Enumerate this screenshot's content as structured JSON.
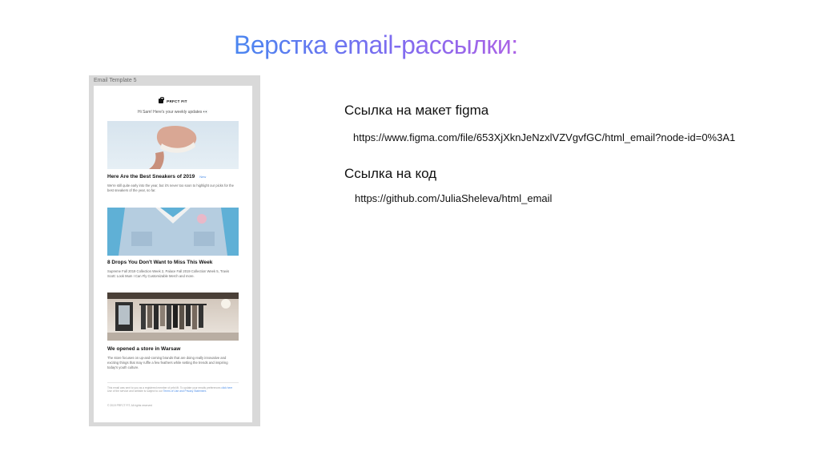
{
  "slide": {
    "title": "Верстка email-рассылки:"
  },
  "preview": {
    "frame_label": "Email Template 5",
    "brand": "PRFCT FIT",
    "greeting": "Hi Sam! Here's your weekly updates 👀",
    "cards": [
      {
        "title": "Here Are the Best Sneakers of 2019",
        "badge": "New",
        "text": "We're still quite early into the year, but it's never too soon to highlight our picks for the best sneakers of the year, so far."
      },
      {
        "title": "8 Drops You Don't Want to Miss This Week",
        "text": "Supreme Fall 2019 Collection Week 2, Palace Fall 2019 Collection Week 5, Travis Scott: Look Mum I Can Fly Customizable Merch and more."
      },
      {
        "title": "We opened a store in Warsaw",
        "text": "The store focuses on up-and-coming brands that are doing really innovative and exciting things that may ruffle a few feathers while setting the trends and inspiring today's youth culture."
      }
    ],
    "footer": {
      "line1": "This email was sent to you as a registered member of prfct.fit. To update your emails preferences",
      "link1": "click here",
      "line2": "Use of the service and website is subject to our",
      "link2": "Terms of Use and Privacy Statement.",
      "copyright": "© 2019 PRFCT FIT. All rights reserved"
    }
  },
  "links": {
    "figma_label": "Ссылка на макет figma",
    "figma_url": "https://www.figma.com/file/653XjXknJeNzxlVZVgvfGC/html_email?node-id=0%3A1",
    "code_label": "Ссылка на код",
    "code_url": "https://github.com/JuliaSheleva/html_email"
  }
}
